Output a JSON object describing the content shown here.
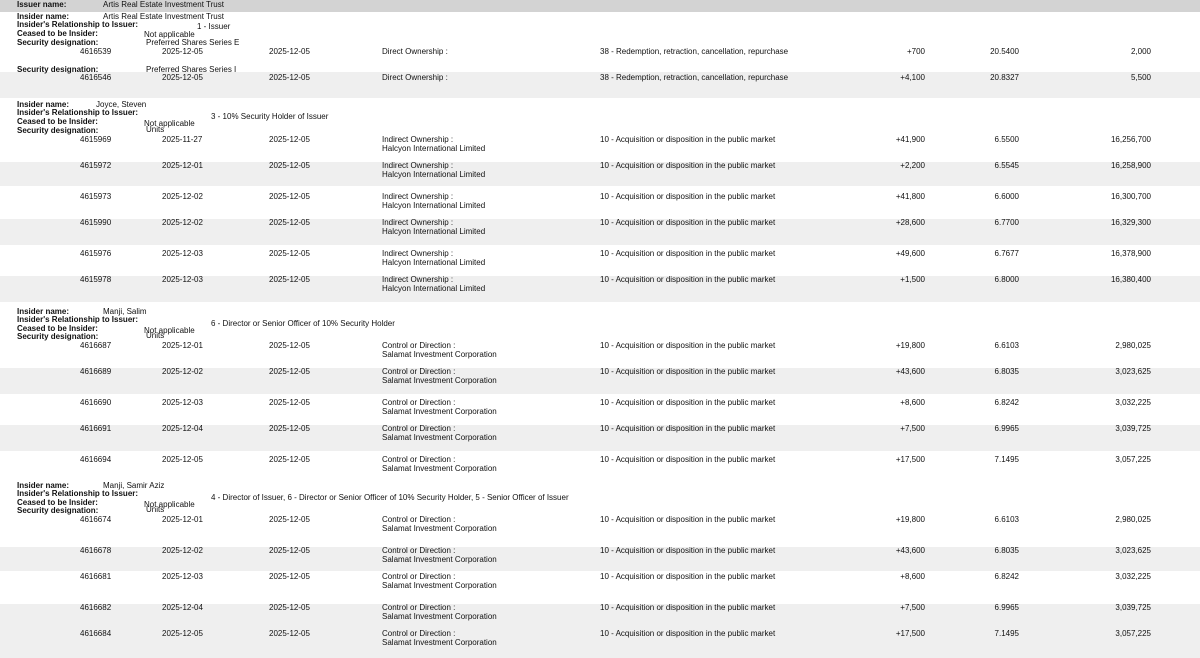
{
  "issuer": {
    "label": "Issuer name:",
    "name": "Artis Real Estate Investment Trust"
  },
  "labels": {
    "insider_name": "Insider name:",
    "relationship": "Insider's Relationship to Issuer:",
    "ceased": "Ceased to be Insider:",
    "security": "Security designation:"
  },
  "insiders": [
    {
      "name": "Artis Real Estate Investment Trust",
      "relationship": "1 - Issuer",
      "ceased": "Not applicable",
      "securities": [
        {
          "designation": "Preferred Shares Series E",
          "rows": [
            {
              "id": "4616539",
              "trade_date": "2025-12-05",
              "filing_date": "2025-12-05",
              "ownership": "Direct Ownership :",
              "holder": "",
              "nature": "38 - Redemption, retraction, cancellation, repurchase",
              "change": "+700",
              "price": "20.5400",
              "balance": "2,000"
            }
          ]
        },
        {
          "designation": "Preferred Shares Series I",
          "rows": [
            {
              "id": "4616546",
              "trade_date": "2025-12-05",
              "filing_date": "2025-12-05",
              "ownership": "Direct Ownership :",
              "holder": "",
              "nature": "38 - Redemption, retraction, cancellation, repurchase",
              "change": "+4,100",
              "price": "20.8327",
              "balance": "5,500"
            }
          ]
        }
      ]
    },
    {
      "name": "Joyce, Steven",
      "relationship": "3 - 10% Security Holder of Issuer",
      "ceased": "Not applicable",
      "securities": [
        {
          "designation": "Units",
          "rows": [
            {
              "id": "4615969",
              "trade_date": "2025-11-27",
              "filing_date": "2025-12-05",
              "ownership": "Indirect Ownership :",
              "holder": "Halcyon International Limited",
              "nature": "10 - Acquisition or disposition in the public market",
              "change": "+41,900",
              "price": "6.5500",
              "balance": "16,256,700"
            },
            {
              "id": "4615972",
              "trade_date": "2025-12-01",
              "filing_date": "2025-12-05",
              "ownership": "Indirect Ownership :",
              "holder": "Halcyon International Limited",
              "nature": "10 - Acquisition or disposition in the public market",
              "change": "+2,200",
              "price": "6.5545",
              "balance": "16,258,900"
            },
            {
              "id": "4615973",
              "trade_date": "2025-12-02",
              "filing_date": "2025-12-05",
              "ownership": "Indirect Ownership :",
              "holder": "Halcyon International Limited",
              "nature": "10 - Acquisition or disposition in the public market",
              "change": "+41,800",
              "price": "6.6000",
              "balance": "16,300,700"
            },
            {
              "id": "4615990",
              "trade_date": "2025-12-02",
              "filing_date": "2025-12-05",
              "ownership": "Indirect Ownership :",
              "holder": "Halcyon International Limited",
              "nature": "10 - Acquisition or disposition in the public market",
              "change": "+28,600",
              "price": "6.7700",
              "balance": "16,329,300"
            },
            {
              "id": "4615976",
              "trade_date": "2025-12-03",
              "filing_date": "2025-12-05",
              "ownership": "Indirect Ownership :",
              "holder": "Halcyon International Limited",
              "nature": "10 - Acquisition or disposition in the public market",
              "change": "+49,600",
              "price": "6.7677",
              "balance": "16,378,900"
            },
            {
              "id": "4615978",
              "trade_date": "2025-12-03",
              "filing_date": "2025-12-05",
              "ownership": "Indirect Ownership :",
              "holder": "Halcyon International Limited",
              "nature": "10 - Acquisition or disposition in the public market",
              "change": "+1,500",
              "price": "6.8000",
              "balance": "16,380,400"
            }
          ]
        }
      ]
    },
    {
      "name": "Manji, Salim",
      "relationship": "6 - Director or Senior Officer of 10% Security Holder",
      "ceased": "Not applicable",
      "securities": [
        {
          "designation": "Units",
          "rows": [
            {
              "id": "4616687",
              "trade_date": "2025-12-01",
              "filing_date": "2025-12-05",
              "ownership": "Control or Direction :",
              "holder": "Salamat Investment Corporation",
              "nature": "10 - Acquisition or disposition in the public market",
              "change": "+19,800",
              "price": "6.6103",
              "balance": "2,980,025"
            },
            {
              "id": "4616689",
              "trade_date": "2025-12-02",
              "filing_date": "2025-12-05",
              "ownership": "Control or Direction :",
              "holder": "Salamat Investment Corporation",
              "nature": "10 - Acquisition or disposition in the public market",
              "change": "+43,600",
              "price": "6.8035",
              "balance": "3,023,625"
            },
            {
              "id": "4616690",
              "trade_date": "2025-12-03",
              "filing_date": "2025-12-05",
              "ownership": "Control or Direction :",
              "holder": "Salamat Investment Corporation",
              "nature": "10 - Acquisition or disposition in the public market",
              "change": "+8,600",
              "price": "6.8242",
              "balance": "3,032,225"
            },
            {
              "id": "4616691",
              "trade_date": "2025-12-04",
              "filing_date": "2025-12-05",
              "ownership": "Control or Direction :",
              "holder": "Salamat Investment Corporation",
              "nature": "10 - Acquisition or disposition in the public market",
              "change": "+7,500",
              "price": "6.9965",
              "balance": "3,039,725"
            },
            {
              "id": "4616694",
              "trade_date": "2025-12-05",
              "filing_date": "2025-12-05",
              "ownership": "Control or Direction :",
              "holder": "Salamat Investment Corporation",
              "nature": "10 - Acquisition or disposition in the public market",
              "change": "+17,500",
              "price": "7.1495",
              "balance": "3,057,225"
            }
          ]
        }
      ]
    },
    {
      "name": "Manji, Samir Aziz",
      "relationship": "4 - Director of Issuer, 6 - Director or Senior Officer of 10% Security Holder, 5 - Senior Officer of Issuer",
      "ceased": "Not applicable",
      "securities": [
        {
          "designation": "Units",
          "rows": [
            {
              "id": "4616674",
              "trade_date": "2025-12-01",
              "filing_date": "2025-12-05",
              "ownership": "Control or Direction :",
              "holder": "Salamat Investment Corporation",
              "nature": "10 - Acquisition or disposition in the public market",
              "change": "+19,800",
              "price": "6.6103",
              "balance": "2,980,025"
            },
            {
              "id": "4616678",
              "trade_date": "2025-12-02",
              "filing_date": "2025-12-05",
              "ownership": "Control or Direction :",
              "holder": "Salamat Investment Corporation",
              "nature": "10 - Acquisition or disposition in the public market",
              "change": "+43,600",
              "price": "6.8035",
              "balance": "3,023,625"
            },
            {
              "id": "4616681",
              "trade_date": "2025-12-03",
              "filing_date": "2025-12-05",
              "ownership": "Control or Direction :",
              "holder": "Salamat Investment Corporation",
              "nature": "10 - Acquisition or disposition in the public market",
              "change": "+8,600",
              "price": "6.8242",
              "balance": "3,032,225"
            },
            {
              "id": "4616682",
              "trade_date": "2025-12-04",
              "filing_date": "2025-12-05",
              "ownership": "Control or Direction :",
              "holder": "Salamat Investment Corporation",
              "nature": "10 - Acquisition or disposition in the public market",
              "change": "+7,500",
              "price": "6.9965",
              "balance": "3,039,725"
            },
            {
              "id": "4616684",
              "trade_date": "2025-12-05",
              "filing_date": "2025-12-05",
              "ownership": "Control or Direction :",
              "holder": "Salamat Investment Corporation",
              "nature": "10 - Acquisition or disposition in the public market",
              "change": "+17,500",
              "price": "7.1495",
              "balance": "3,057,225"
            }
          ]
        }
      ]
    }
  ]
}
